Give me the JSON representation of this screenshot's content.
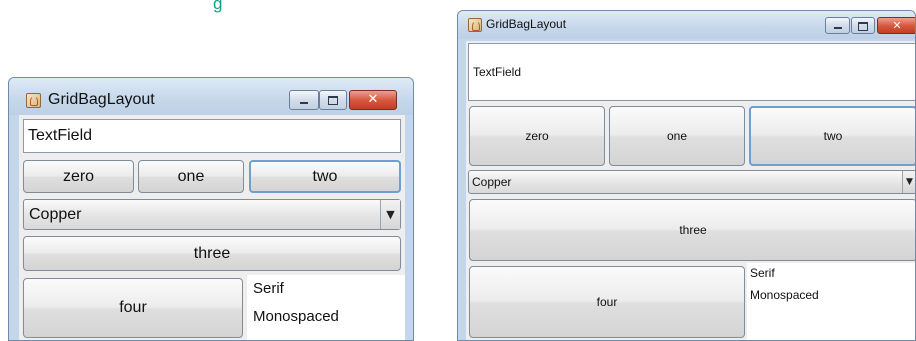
{
  "caption": "g",
  "window_left": {
    "title": "GridBagLayout",
    "textfield_value": "TextField",
    "buttons": {
      "zero": "zero",
      "one": "one",
      "two": "two",
      "three": "three",
      "four": "four"
    },
    "combo_value": "Copper",
    "combo_arrow": "▼",
    "list_items": [
      "Serif",
      "Monospaced"
    ],
    "close_glyph": "✕"
  },
  "window_right": {
    "title": "GridBagLayout",
    "textfield_value": "TextField",
    "buttons": {
      "zero": "zero",
      "one": "one",
      "two": "two",
      "three": "three",
      "four": "four"
    },
    "combo_value": "Copper",
    "combo_arrow": "▼",
    "list_items": [
      "Serif",
      "Monospaced"
    ],
    "close_glyph": "✕"
  }
}
